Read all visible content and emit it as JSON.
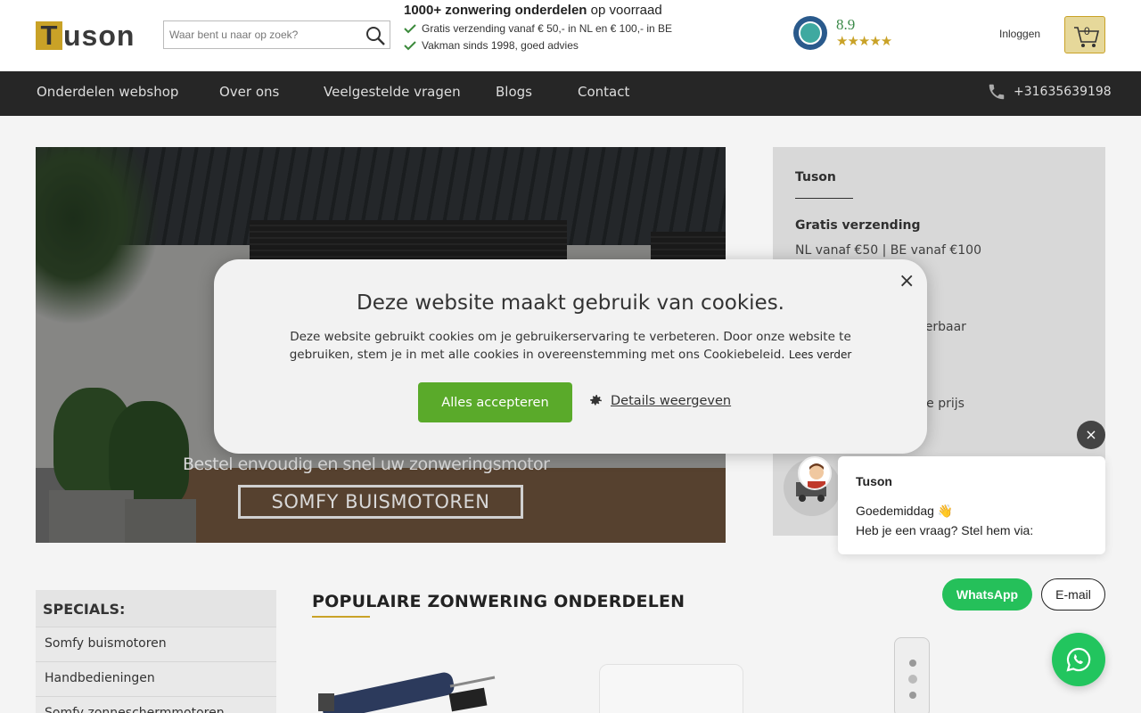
{
  "header": {
    "logo_initial": "T",
    "logo_rest": "uson",
    "search_placeholder": "Waar bent u naar op zoek?",
    "usp_title_bold": "1000+ zonwering onderdelen",
    "usp_title_rest": " op voorraad",
    "usps": [
      "Gratis verzending vanaf € 50,- in NL en € 100,- in BE",
      "Vakman sinds 1998, goed advies"
    ],
    "rating_score": "8.9",
    "rating_stars": "★★★★★",
    "login_label": "Inloggen",
    "cart_count": "0"
  },
  "nav": {
    "items": [
      "Onderdelen webshop",
      "Over ons",
      "Veelgestelde vragen",
      "Blogs",
      "Contact"
    ],
    "phone": "+31635639198"
  },
  "hero": {
    "caption": "Bestel envoudig en snel uw zonweringsmotor",
    "button_label": "SOMFY BUISMOTOREN"
  },
  "info_panel": {
    "title": "Tuson",
    "heading_1": "Gratis verzending",
    "text_1": "NL vanaf €50 | BE vanaf €100",
    "text_2_partial": "t leverbaar",
    "text_3_partial": "herpe prijs"
  },
  "sidebar": {
    "heading": "SPECIALS:",
    "items": [
      "Somfy buismotoren",
      "Handbedieningen",
      "Somfy zonneschermmotoren"
    ]
  },
  "popular": {
    "title": "POPULAIRE ZONWERING ONDERDELEN"
  },
  "cookie_modal": {
    "title": "Deze website maakt gebruik van cookies.",
    "text": "Deze website gebruikt cookies om je gebruikerservaring te verbeteren. Door onze website te gebruiken, stem je in met alle cookies in overeenstemming met ons Cookiebeleid. ",
    "read_more": "Lees verder",
    "accept_label": "Alles accepteren",
    "details_label": "Details weergeven",
    "close_symbol": "×"
  },
  "chat": {
    "close_symbol": "×",
    "name": "Tuson",
    "greeting": "Goedemiddag 👋",
    "question": "Heb je een vraag? Stel hem via:",
    "whatsapp_label": "WhatsApp",
    "email_label": "E-mail"
  },
  "colors": {
    "brand_gold": "#c9a227",
    "nav_bg": "#262626",
    "accept_green": "#5aaa2a",
    "whatsapp_green": "#25c05a"
  }
}
